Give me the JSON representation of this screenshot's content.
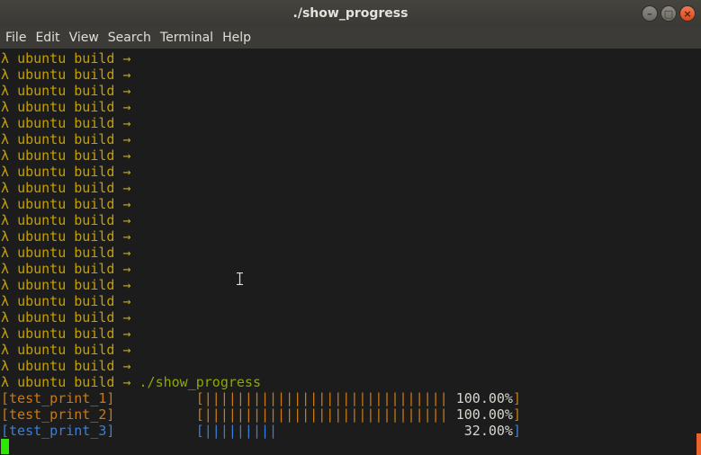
{
  "window": {
    "title": "./show_progress",
    "controls": {
      "minimize": "–",
      "maximize": "□",
      "close": "×"
    }
  },
  "menu": [
    "File",
    "Edit",
    "View",
    "Search",
    "Terminal",
    "Help"
  ],
  "terminal": {
    "prompt_symbol": "λ",
    "prompt_host": "ubuntu build",
    "prompt_arrow": "→",
    "empty_prompt_count": 20,
    "last_command": "./show_progress",
    "progress": [
      {
        "label": "[test_print_1]",
        "bar": "[||||||||||||||||||||||||||||||",
        "percent_text": "100.00%",
        "close": "]",
        "value": 100.0,
        "color": "#cc7a0e"
      },
      {
        "label": "[test_print_2]",
        "bar": "[||||||||||||||||||||||||||||||",
        "percent_text": "100.00%",
        "close": "]",
        "value": 100.0,
        "color": "#cc7a0e"
      },
      {
        "label": "[test_print_3]",
        "bar": "[|||||||||",
        "percent_text": "32.00%",
        "close": "]",
        "value": 32.0,
        "color": "#3b7fd6"
      }
    ]
  },
  "colors": {
    "terminal_bg": "#1c1c1c",
    "prompt": "#c4a000",
    "command": "#8fa700",
    "progress_done": "#cc7a0e",
    "progress_active": "#3b7fd6",
    "cursor": "#2ee700"
  }
}
